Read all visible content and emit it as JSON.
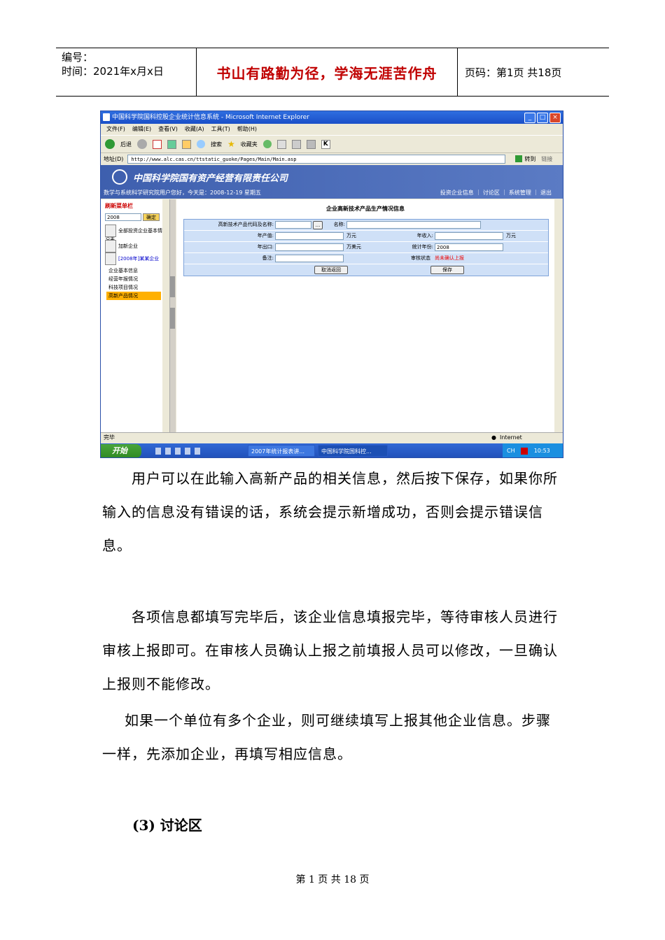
{
  "header": {
    "number_label": "编号：",
    "date_label": "时间：2021年x月x日",
    "motto": "书山有路勤为径，学海无涯苦作舟",
    "page_info": "页码：第1页  共18页"
  },
  "screenshot": {
    "window_title": "中国科学院国科控股企业统计信息系统 - Microsoft Internet Explorer",
    "menu": [
      "文件(F)",
      "编辑(E)",
      "查看(V)",
      "收藏(A)",
      "工具(T)",
      "帮助(H)"
    ],
    "toolbar": {
      "back": "后退",
      "search": "搜索",
      "favorites": "收藏夹"
    },
    "address_label": "地址(D)",
    "address_value": "http://www.alc.cas.cn/ttstatic_guoke/Pages/Main/Main.asp",
    "go_label": "转到",
    "links_label": "链接",
    "org_name": "中国科学院国有资产经营有限责任公司",
    "welcome": "数学与系统科学研究院用户您好，今天是：2008-12-19 星期五",
    "top_links": "投资企业信息 ｜ 讨论区 ｜ 系统管理 ｜ 退出",
    "sidebar": {
      "refresh": "刷新菜单栏",
      "year": "2008",
      "ok": "确定",
      "tree": [
        "全部投资企业基本情况表",
        "加新企业",
        "[2008年]某某企业"
      ],
      "menu": [
        "企业基本信息",
        "经营年报情况",
        "科技项目情况",
        "高新产品情况"
      ]
    },
    "form": {
      "title": "企业高新技术产品生产情况信息",
      "code_label": "高新技术产品代码及名称:",
      "name_label": "名称:",
      "output_label": "年产值:",
      "output_unit": "万元",
      "income_label": "年收入:",
      "income_unit": "万元",
      "export_label": "年出口:",
      "export_unit": "万美元",
      "year_label": "统计年份:",
      "year_value": "2008",
      "remark_label": "备注:",
      "status_label": "审核状态",
      "status_value": "尚未确认上报",
      "cancel_button": "取消返回",
      "save_button": "保存",
      "browse_button": "..."
    },
    "status": "完毕",
    "zone": "Internet",
    "taskbar": {
      "start": "开始",
      "task1": "2007年统计报表讲...",
      "task2": "中国科学院国科控...",
      "lang": "CH",
      "time": "10:53"
    }
  },
  "body": {
    "p1": "用户可以在此输入高新产品的相关信息，然后按下保存，如果你所输入的信息没有错误的话，系统会提示新增成功，否则会提示错误信息。",
    "p2": "各项信息都填写完毕后，该企业信息填报完毕，等待审核人员进行审核上报即可。在审核人员确认上报之前填报人员可以修改，一旦确认上报则不能修改。",
    "p3": "如果一个单位有多个企业，则可继续填写上报其他企业信息。步骤一样，先添加企业，再填写相应信息。",
    "section": "(3) 讨论区"
  },
  "footer": "第 1 页 共 18 页"
}
